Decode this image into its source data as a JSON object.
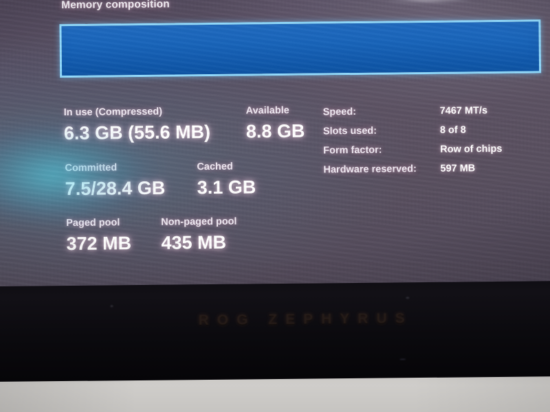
{
  "photo": {
    "scene": "photograph of a laptop screen showing Windows Task Manager memory details",
    "device_brand": "ROG ZEPHYRUS"
  },
  "screen": {
    "section_title": "Memory composition",
    "memory_composition_bar": {
      "border_color": "#8fd8fb",
      "fill_color": "#1161bb",
      "segments": [
        {
          "name": "in-use",
          "percent": 100
        }
      ]
    },
    "stats": [
      {
        "id": "in-use",
        "label": "In use (Compressed)",
        "value": "6.3 GB (55.6 MB)"
      },
      {
        "id": "available",
        "label": "Available",
        "value": "8.8 GB"
      },
      {
        "id": "committed",
        "label": "Committed",
        "value": "7.5/28.4 GB"
      },
      {
        "id": "cached",
        "label": "Cached",
        "value": "3.1 GB"
      },
      {
        "id": "paged-pool",
        "label": "Paged pool",
        "value": "372 MB"
      },
      {
        "id": "nonpaged-pool",
        "label": "Non-paged pool",
        "value": "435 MB"
      }
    ],
    "specs": [
      {
        "id": "speed",
        "key": "Speed:",
        "value": "7467 MT/s"
      },
      {
        "id": "slots-used",
        "key": "Slots used:",
        "value": "8 of 8"
      },
      {
        "id": "form-factor",
        "key": "Form factor:",
        "value": "Row of chips"
      },
      {
        "id": "hardware-reserved",
        "key": "Hardware reserved:",
        "value": "597 MB"
      }
    ]
  },
  "colors": {
    "screen_background": "#554b60",
    "text_primary": "#ffffff",
    "text_label": "#efe9f2",
    "accent_blue": "#1161bb",
    "accent_border": "#8fd8fb",
    "glare_cyan": "#50dcf0",
    "bezel": "#0d0c10",
    "desk": "#c9c7c4"
  }
}
